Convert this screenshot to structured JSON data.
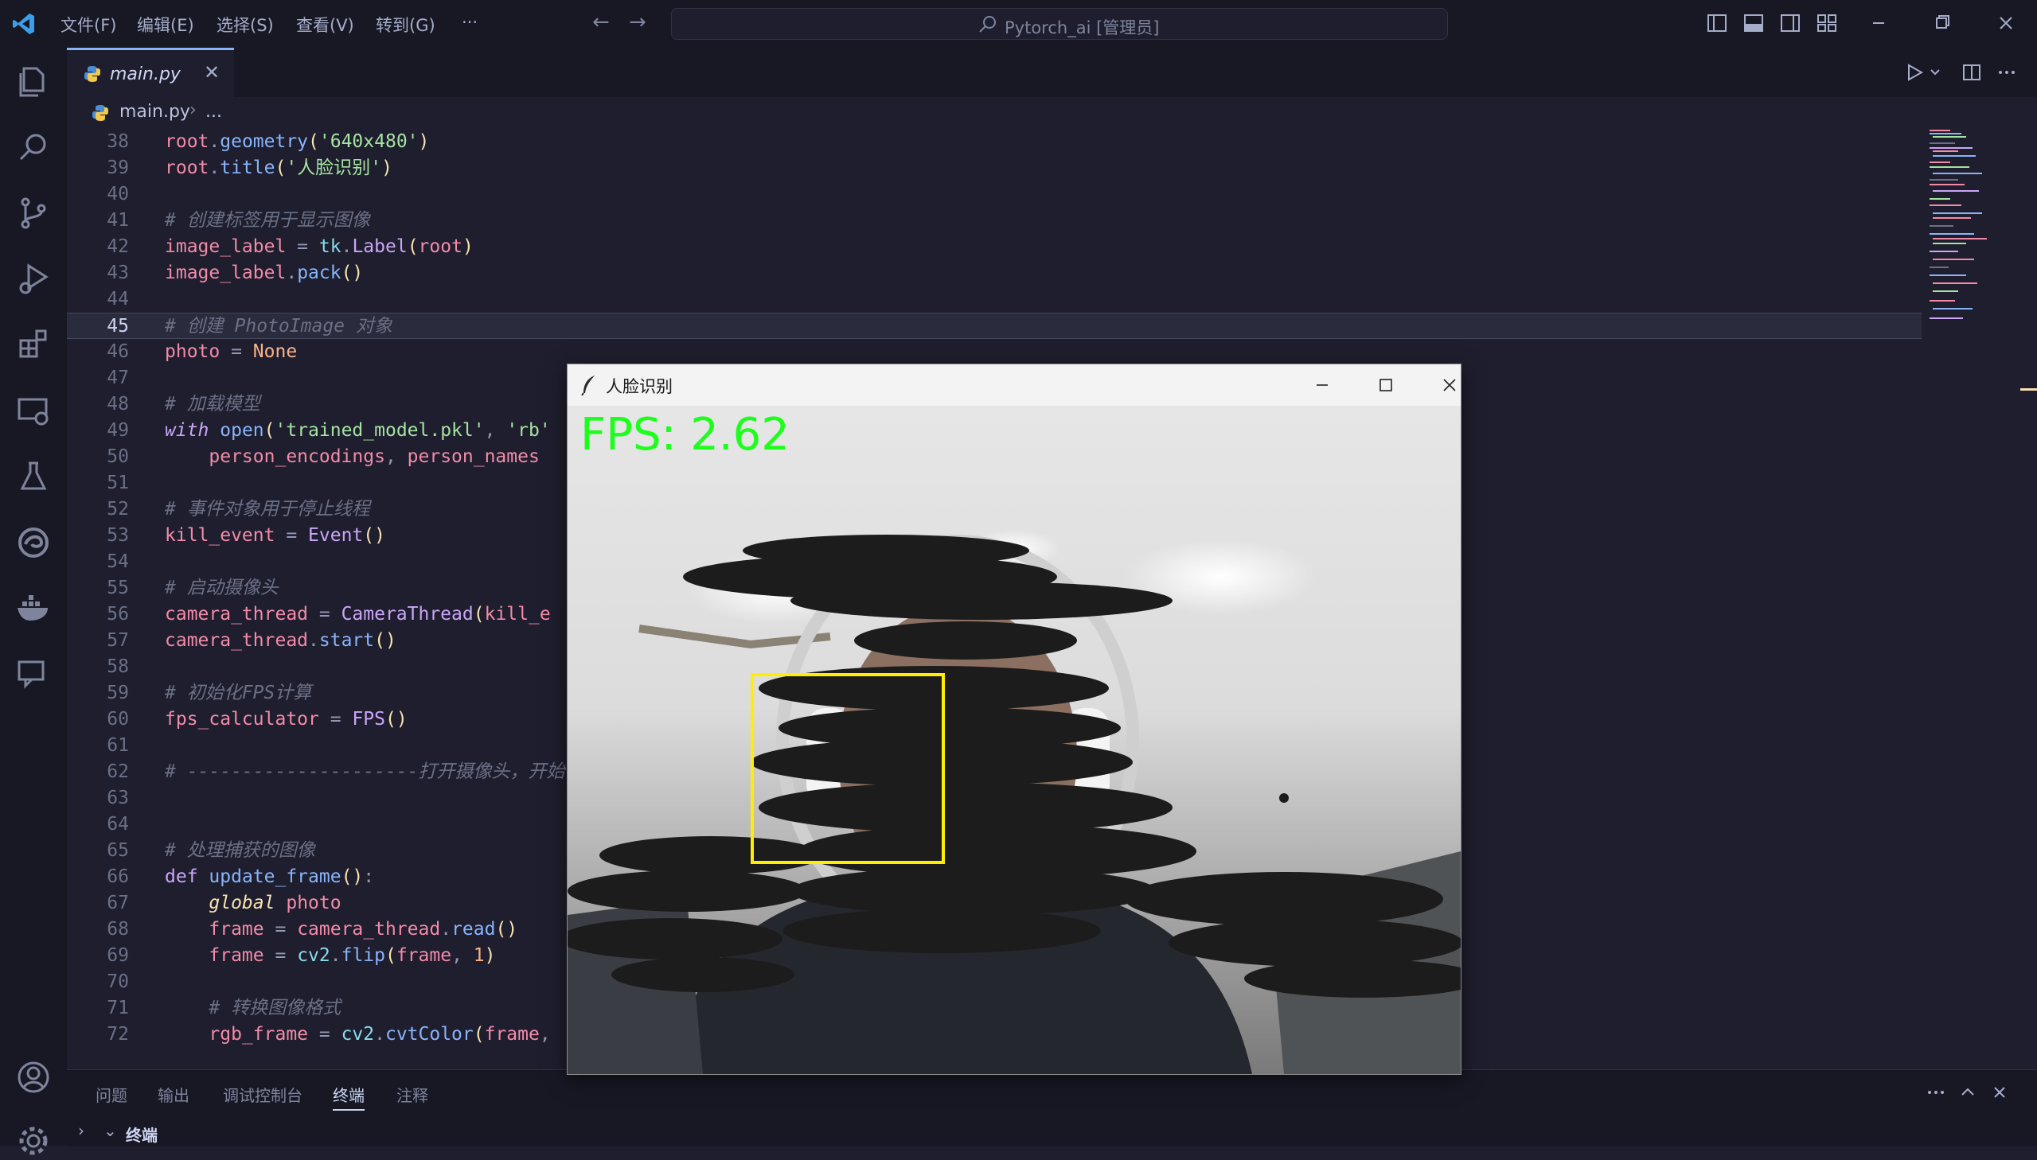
{
  "titlebar": {
    "menu": [
      "文件(F)",
      "编辑(E)",
      "选择(S)",
      "查看(V)",
      "转到(G)",
      "···"
    ],
    "command_center": "Pytorch_ai [管理员]"
  },
  "tab": {
    "label": "main.py"
  },
  "breadcrumb": {
    "file": "main.py",
    "separator": "›",
    "more": "..."
  },
  "code_lines": [
    {
      "n": "38",
      "text": "root.geometry('640x480')"
    },
    {
      "n": "39",
      "text": "root.title('人脸识别')"
    },
    {
      "n": "40",
      "text": ""
    },
    {
      "n": "41",
      "text": "# 创建标签用于显示图像"
    },
    {
      "n": "42",
      "text": "image_label = tk.Label(root)"
    },
    {
      "n": "43",
      "text": "image_label.pack()"
    },
    {
      "n": "44",
      "text": ""
    },
    {
      "n": "45",
      "text": "# 创建 PhotoImage 对象"
    },
    {
      "n": "46",
      "text": "photo = None"
    },
    {
      "n": "47",
      "text": ""
    },
    {
      "n": "48",
      "text": "# 加载模型"
    },
    {
      "n": "49",
      "text": "with open('trained_model.pkl', 'rb'"
    },
    {
      "n": "50",
      "text": "    person_encodings, person_names"
    },
    {
      "n": "51",
      "text": ""
    },
    {
      "n": "52",
      "text": "# 事件对象用于停止线程"
    },
    {
      "n": "53",
      "text": "kill_event = Event()"
    },
    {
      "n": "54",
      "text": ""
    },
    {
      "n": "55",
      "text": "# 启动摄像头"
    },
    {
      "n": "56",
      "text": "camera_thread = CameraThread(kill_e"
    },
    {
      "n": "57",
      "text": "camera_thread.start()"
    },
    {
      "n": "58",
      "text": ""
    },
    {
      "n": "59",
      "text": "# 初始化FPS计算"
    },
    {
      "n": "60",
      "text": "fps_calculator = FPS()"
    },
    {
      "n": "61",
      "text": ""
    },
    {
      "n": "62",
      "text": "# ---------------------打开摄像头，开始"
    },
    {
      "n": "63",
      "text": ""
    },
    {
      "n": "64",
      "text": ""
    },
    {
      "n": "65",
      "text": "# 处理捕获的图像"
    },
    {
      "n": "66",
      "text": "def update_frame():"
    },
    {
      "n": "67",
      "text": "    global photo"
    },
    {
      "n": "68",
      "text": "    frame = camera_thread.read()"
    },
    {
      "n": "69",
      "text": "    frame = cv2.flip(frame, 1)"
    },
    {
      "n": "70",
      "text": ""
    },
    {
      "n": "71",
      "text": "    # 转换图像格式"
    },
    {
      "n": "72",
      "text": "    rgb_frame = cv2.cvtColor(frame,"
    }
  ],
  "panel": {
    "tabs": [
      "问题",
      "输出",
      "调试控制台",
      "终端",
      "注释"
    ],
    "active_tab": "终端",
    "terminal_label": "终端"
  },
  "tk_window": {
    "title": "人脸识别",
    "fps_label": "FPS: 2.62"
  },
  "colors": {
    "editor_bg": "#1e1e2e",
    "chrome_bg": "#181825",
    "fps_text": "#1bff1b",
    "face_box": "#ffee00"
  }
}
